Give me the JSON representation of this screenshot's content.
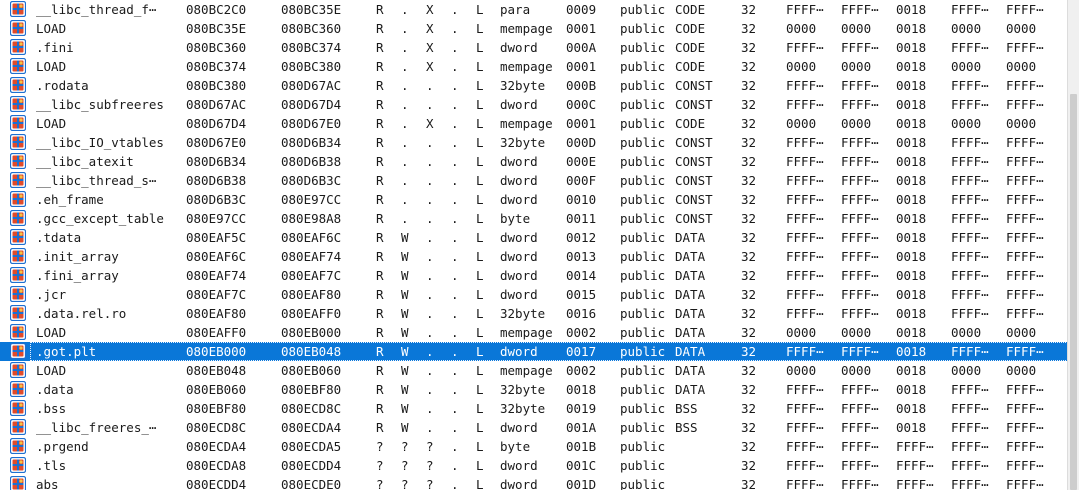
{
  "segments": [
    {
      "name": "__libc_thread_f⋯",
      "start": "080BC2C0",
      "end": "080BC35E",
      "r": "R",
      "w": ".",
      "x": "X",
      "d": ".",
      "l": "L",
      "align": "para",
      "base": "0009",
      "type": "public",
      "class": "CODE",
      "ad": "32",
      "t1": "FFFF⋯",
      "t2": "FFFF⋯",
      "t3": "0018",
      "t4": "FFFF⋯",
      "t5": "FFFF⋯"
    },
    {
      "name": "LOAD",
      "start": "080BC35E",
      "end": "080BC360",
      "r": "R",
      "w": ".",
      "x": "X",
      "d": ".",
      "l": "L",
      "align": "mempage",
      "base": "0001",
      "type": "public",
      "class": "CODE",
      "ad": "32",
      "t1": "0000",
      "t2": "0000",
      "t3": "0018",
      "t4": "0000",
      "t5": "0000"
    },
    {
      "name": ".fini",
      "start": "080BC360",
      "end": "080BC374",
      "r": "R",
      "w": ".",
      "x": "X",
      "d": ".",
      "l": "L",
      "align": "dword",
      "base": "000A",
      "type": "public",
      "class": "CODE",
      "ad": "32",
      "t1": "FFFF⋯",
      "t2": "FFFF⋯",
      "t3": "0018",
      "t4": "FFFF⋯",
      "t5": "FFFF⋯"
    },
    {
      "name": "LOAD",
      "start": "080BC374",
      "end": "080BC380",
      "r": "R",
      "w": ".",
      "x": "X",
      "d": ".",
      "l": "L",
      "align": "mempage",
      "base": "0001",
      "type": "public",
      "class": "CODE",
      "ad": "32",
      "t1": "0000",
      "t2": "0000",
      "t3": "0018",
      "t4": "0000",
      "t5": "0000"
    },
    {
      "name": ".rodata",
      "start": "080BC380",
      "end": "080D67AC",
      "r": "R",
      "w": ".",
      "x": ".",
      "d": ".",
      "l": "L",
      "align": "32byte",
      "base": "000B",
      "type": "public",
      "class": "CONST",
      "ad": "32",
      "t1": "FFFF⋯",
      "t2": "FFFF⋯",
      "t3": "0018",
      "t4": "FFFF⋯",
      "t5": "FFFF⋯"
    },
    {
      "name": "__libc_subfreeres",
      "start": "080D67AC",
      "end": "080D67D4",
      "r": "R",
      "w": ".",
      "x": ".",
      "d": ".",
      "l": "L",
      "align": "dword",
      "base": "000C",
      "type": "public",
      "class": "CONST",
      "ad": "32",
      "t1": "FFFF⋯",
      "t2": "FFFF⋯",
      "t3": "0018",
      "t4": "FFFF⋯",
      "t5": "FFFF⋯"
    },
    {
      "name": "LOAD",
      "start": "080D67D4",
      "end": "080D67E0",
      "r": "R",
      "w": ".",
      "x": "X",
      "d": ".",
      "l": "L",
      "align": "mempage",
      "base": "0001",
      "type": "public",
      "class": "CODE",
      "ad": "32",
      "t1": "0000",
      "t2": "0000",
      "t3": "0018",
      "t4": "0000",
      "t5": "0000"
    },
    {
      "name": "__libc_IO_vtables",
      "start": "080D67E0",
      "end": "080D6B34",
      "r": "R",
      "w": ".",
      "x": ".",
      "d": ".",
      "l": "L",
      "align": "32byte",
      "base": "000D",
      "type": "public",
      "class": "CONST",
      "ad": "32",
      "t1": "FFFF⋯",
      "t2": "FFFF⋯",
      "t3": "0018",
      "t4": "FFFF⋯",
      "t5": "FFFF⋯"
    },
    {
      "name": "__libc_atexit",
      "start": "080D6B34",
      "end": "080D6B38",
      "r": "R",
      "w": ".",
      "x": ".",
      "d": ".",
      "l": "L",
      "align": "dword",
      "base": "000E",
      "type": "public",
      "class": "CONST",
      "ad": "32",
      "t1": "FFFF⋯",
      "t2": "FFFF⋯",
      "t3": "0018",
      "t4": "FFFF⋯",
      "t5": "FFFF⋯"
    },
    {
      "name": "__libc_thread_s⋯",
      "start": "080D6B38",
      "end": "080D6B3C",
      "r": "R",
      "w": ".",
      "x": ".",
      "d": ".",
      "l": "L",
      "align": "dword",
      "base": "000F",
      "type": "public",
      "class": "CONST",
      "ad": "32",
      "t1": "FFFF⋯",
      "t2": "FFFF⋯",
      "t3": "0018",
      "t4": "FFFF⋯",
      "t5": "FFFF⋯"
    },
    {
      "name": ".eh_frame",
      "start": "080D6B3C",
      "end": "080E97CC",
      "r": "R",
      "w": ".",
      "x": ".",
      "d": ".",
      "l": "L",
      "align": "dword",
      "base": "0010",
      "type": "public",
      "class": "CONST",
      "ad": "32",
      "t1": "FFFF⋯",
      "t2": "FFFF⋯",
      "t3": "0018",
      "t4": "FFFF⋯",
      "t5": "FFFF⋯"
    },
    {
      "name": ".gcc_except_table",
      "start": "080E97CC",
      "end": "080E98A8",
      "r": "R",
      "w": ".",
      "x": ".",
      "d": ".",
      "l": "L",
      "align": "byte",
      "base": "0011",
      "type": "public",
      "class": "CONST",
      "ad": "32",
      "t1": "FFFF⋯",
      "t2": "FFFF⋯",
      "t3": "0018",
      "t4": "FFFF⋯",
      "t5": "FFFF⋯"
    },
    {
      "name": ".tdata",
      "start": "080EAF5C",
      "end": "080EAF6C",
      "r": "R",
      "w": "W",
      "x": ".",
      "d": ".",
      "l": "L",
      "align": "dword",
      "base": "0012",
      "type": "public",
      "class": "DATA",
      "ad": "32",
      "t1": "FFFF⋯",
      "t2": "FFFF⋯",
      "t3": "0018",
      "t4": "FFFF⋯",
      "t5": "FFFF⋯"
    },
    {
      "name": ".init_array",
      "start": "080EAF6C",
      "end": "080EAF74",
      "r": "R",
      "w": "W",
      "x": ".",
      "d": ".",
      "l": "L",
      "align": "dword",
      "base": "0013",
      "type": "public",
      "class": "DATA",
      "ad": "32",
      "t1": "FFFF⋯",
      "t2": "FFFF⋯",
      "t3": "0018",
      "t4": "FFFF⋯",
      "t5": "FFFF⋯"
    },
    {
      "name": ".fini_array",
      "start": "080EAF74",
      "end": "080EAF7C",
      "r": "R",
      "w": "W",
      "x": ".",
      "d": ".",
      "l": "L",
      "align": "dword",
      "base": "0014",
      "type": "public",
      "class": "DATA",
      "ad": "32",
      "t1": "FFFF⋯",
      "t2": "FFFF⋯",
      "t3": "0018",
      "t4": "FFFF⋯",
      "t5": "FFFF⋯"
    },
    {
      "name": ".jcr",
      "start": "080EAF7C",
      "end": "080EAF80",
      "r": "R",
      "w": "W",
      "x": ".",
      "d": ".",
      "l": "L",
      "align": "dword",
      "base": "0015",
      "type": "public",
      "class": "DATA",
      "ad": "32",
      "t1": "FFFF⋯",
      "t2": "FFFF⋯",
      "t3": "0018",
      "t4": "FFFF⋯",
      "t5": "FFFF⋯"
    },
    {
      "name": ".data.rel.ro",
      "start": "080EAF80",
      "end": "080EAFF0",
      "r": "R",
      "w": "W",
      "x": ".",
      "d": ".",
      "l": "L",
      "align": "32byte",
      "base": "0016",
      "type": "public",
      "class": "DATA",
      "ad": "32",
      "t1": "FFFF⋯",
      "t2": "FFFF⋯",
      "t3": "0018",
      "t4": "FFFF⋯",
      "t5": "FFFF⋯"
    },
    {
      "name": "LOAD",
      "start": "080EAFF0",
      "end": "080EB000",
      "r": "R",
      "w": "W",
      "x": ".",
      "d": ".",
      "l": "L",
      "align": "mempage",
      "base": "0002",
      "type": "public",
      "class": "DATA",
      "ad": "32",
      "t1": "0000",
      "t2": "0000",
      "t3": "0018",
      "t4": "0000",
      "t5": "0000"
    },
    {
      "name": ".got.plt",
      "start": "080EB000",
      "end": "080EB048",
      "r": "R",
      "w": "W",
      "x": ".",
      "d": ".",
      "l": "L",
      "align": "dword",
      "base": "0017",
      "type": "public",
      "class": "DATA",
      "ad": "32",
      "t1": "FFFF⋯",
      "t2": "FFFF⋯",
      "t3": "0018",
      "t4": "FFFF⋯",
      "t5": "FFFF⋯",
      "selected": true
    },
    {
      "name": "LOAD",
      "start": "080EB048",
      "end": "080EB060",
      "r": "R",
      "w": "W",
      "x": ".",
      "d": ".",
      "l": "L",
      "align": "mempage",
      "base": "0002",
      "type": "public",
      "class": "DATA",
      "ad": "32",
      "t1": "0000",
      "t2": "0000",
      "t3": "0018",
      "t4": "0000",
      "t5": "0000"
    },
    {
      "name": ".data",
      "start": "080EB060",
      "end": "080EBF80",
      "r": "R",
      "w": "W",
      "x": ".",
      "d": ".",
      "l": "L",
      "align": "32byte",
      "base": "0018",
      "type": "public",
      "class": "DATA",
      "ad": "32",
      "t1": "FFFF⋯",
      "t2": "FFFF⋯",
      "t3": "0018",
      "t4": "FFFF⋯",
      "t5": "FFFF⋯"
    },
    {
      "name": ".bss",
      "start": "080EBF80",
      "end": "080ECD8C",
      "r": "R",
      "w": "W",
      "x": ".",
      "d": ".",
      "l": "L",
      "align": "32byte",
      "base": "0019",
      "type": "public",
      "class": "BSS",
      "ad": "32",
      "t1": "FFFF⋯",
      "t2": "FFFF⋯",
      "t3": "0018",
      "t4": "FFFF⋯",
      "t5": "FFFF⋯"
    },
    {
      "name": "__libc_freeres_⋯",
      "start": "080ECD8C",
      "end": "080ECDA4",
      "r": "R",
      "w": "W",
      "x": ".",
      "d": ".",
      "l": "L",
      "align": "dword",
      "base": "001A",
      "type": "public",
      "class": "BSS",
      "ad": "32",
      "t1": "FFFF⋯",
      "t2": "FFFF⋯",
      "t3": "0018",
      "t4": "FFFF⋯",
      "t5": "FFFF⋯"
    },
    {
      "name": ".prgend",
      "start": "080ECDA4",
      "end": "080ECDA5",
      "r": "?",
      "w": "?",
      "x": "?",
      "d": ".",
      "l": "L",
      "align": "byte",
      "base": "001B",
      "type": "public",
      "class": "",
      "ad": "32",
      "t1": "FFFF⋯",
      "t2": "FFFF⋯",
      "t3": "FFFF⋯",
      "t4": "FFFF⋯",
      "t5": "FFFF⋯"
    },
    {
      "name": ".tls",
      "start": "080ECDA8",
      "end": "080ECDD4",
      "r": "?",
      "w": "?",
      "x": "?",
      "d": ".",
      "l": "L",
      "align": "dword",
      "base": "001C",
      "type": "public",
      "class": "",
      "ad": "32",
      "t1": "FFFF⋯",
      "t2": "FFFF⋯",
      "t3": "FFFF⋯",
      "t4": "FFFF⋯",
      "t5": "FFFF⋯"
    },
    {
      "name": "abs",
      "start": "080ECDD4",
      "end": "080ECDE0",
      "r": "?",
      "w": "?",
      "x": "?",
      "d": ".",
      "l": "L",
      "align": "dword",
      "base": "001D",
      "type": "public",
      "class": "",
      "ad": "32",
      "t1": "FFFF⋯",
      "t2": "FFFF⋯",
      "t3": "FFFF⋯",
      "t4": "FFFF⋯",
      "t5": "FFFF⋯"
    }
  ],
  "icon": {
    "name": "segment-icon",
    "colors": {
      "frame": "#1e6fd0",
      "fill": "#e04a2a",
      "accent": "#f6c343"
    }
  },
  "colors": {
    "selection": "#0a77d8",
    "selection_text": "#ffffff",
    "text": "#1a1a1a"
  }
}
